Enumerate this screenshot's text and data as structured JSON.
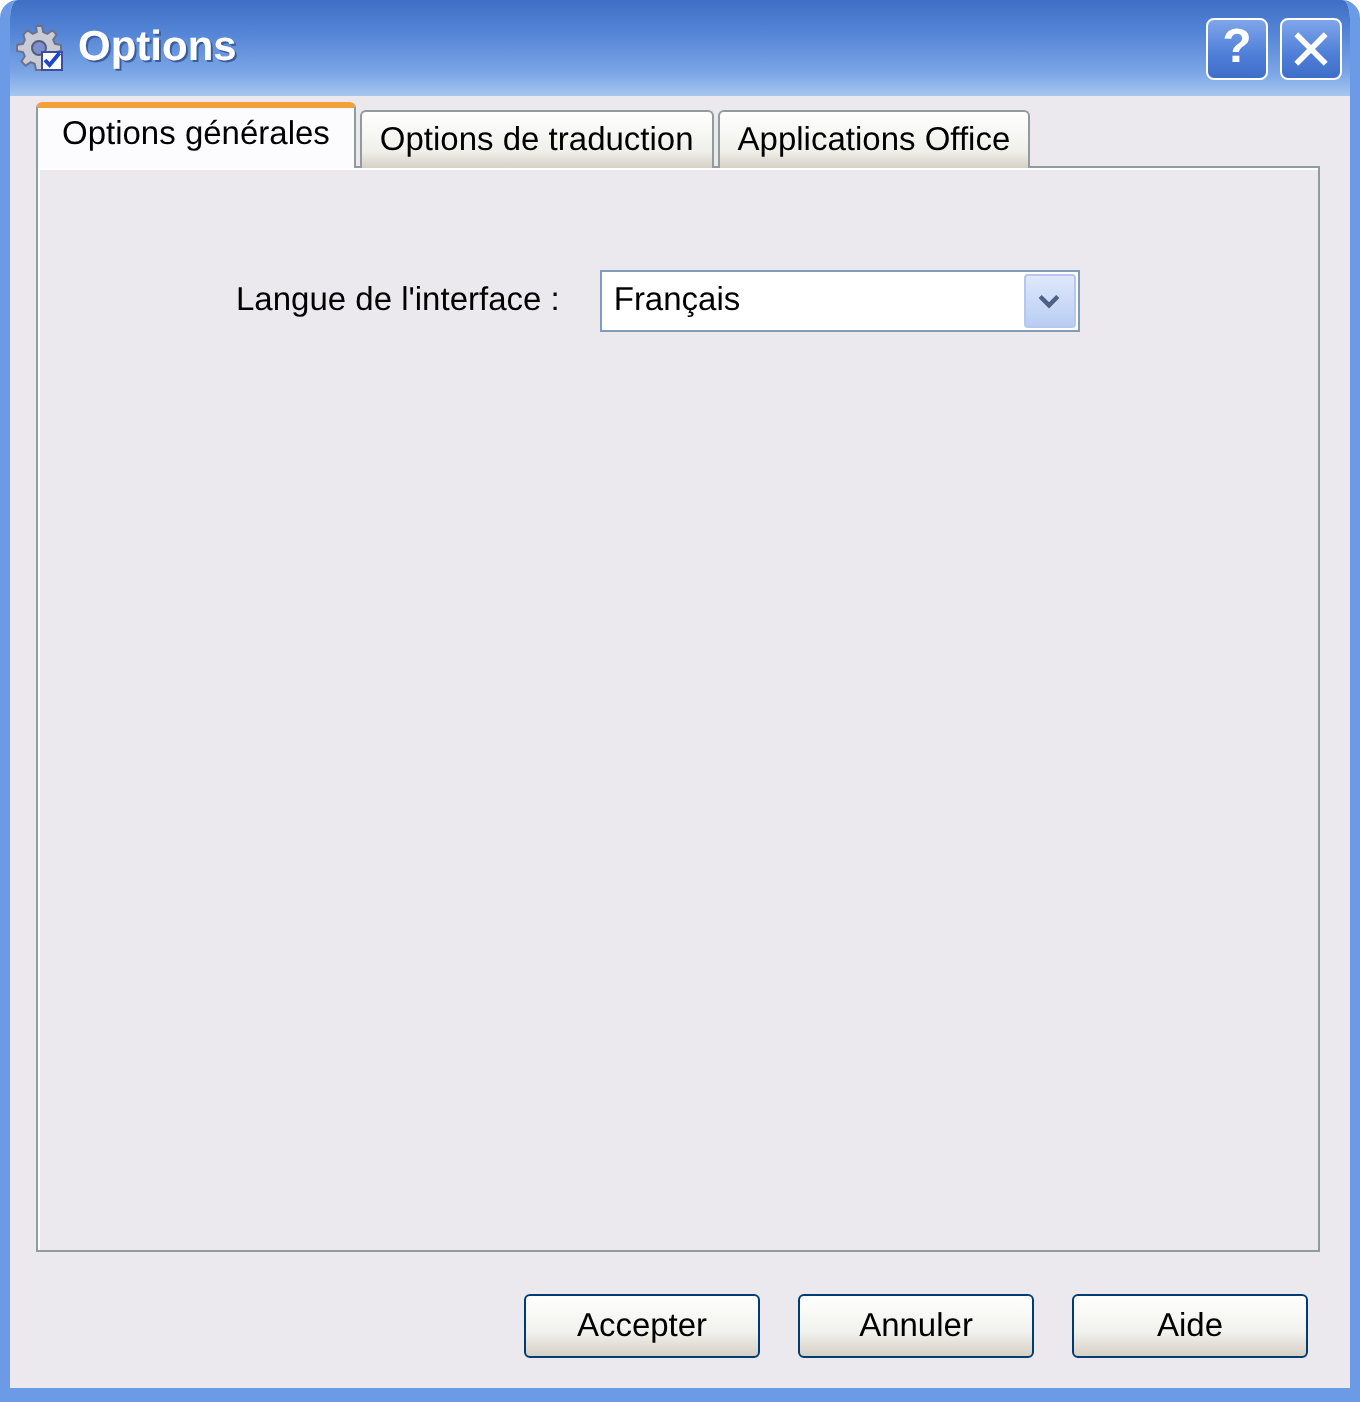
{
  "window": {
    "title": "Options",
    "help_button": "?"
  },
  "tabs": [
    {
      "label": "Options générales",
      "selected": true
    },
    {
      "label": "Options de traduction",
      "selected": false
    },
    {
      "label": "Applications Office",
      "selected": false
    }
  ],
  "language_setting": {
    "label": "Langue de l'interface :",
    "value": "Français"
  },
  "buttons": [
    "Accepter",
    "Annuler",
    "Aide"
  ]
}
